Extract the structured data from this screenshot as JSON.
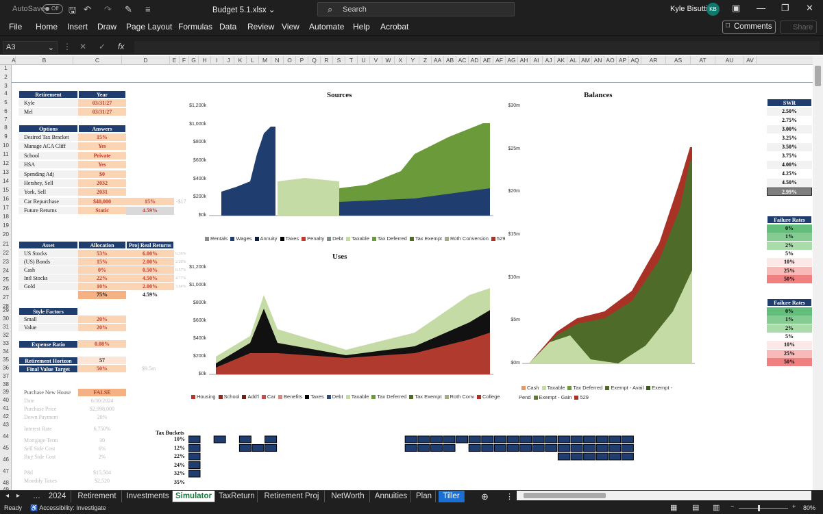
{
  "titlebar": {
    "autosave": "AutoSave",
    "toggle": "Off",
    "filename": "Budget 5.1.xlsx",
    "search": "Search",
    "user": "Kyle Bisutti",
    "initials": "KB"
  },
  "menu": [
    "File",
    "Home",
    "Insert",
    "Draw",
    "Page Layout",
    "Formulas",
    "Data",
    "Review",
    "View",
    "Automate",
    "Help",
    "Acrobat"
  ],
  "buttons": {
    "comments": "Comments",
    "share": "Share"
  },
  "namebox": "A3",
  "columns": [
    "A",
    "B",
    "C",
    "D",
    "E",
    "F",
    "G",
    "H",
    "I",
    "J",
    "K",
    "L",
    "M",
    "N",
    "O",
    "P",
    "Q",
    "R",
    "S",
    "T",
    "U",
    "V",
    "W",
    "X",
    "Y",
    "Z",
    "AA",
    "AB",
    "AC",
    "AD",
    "AE",
    "AF",
    "AG",
    "AH",
    "AI",
    "AJ",
    "AK",
    "AL",
    "AM",
    "AN",
    "AO",
    "AP",
    "AQ",
    "AR",
    "AS",
    "AT",
    "AU",
    "AV"
  ],
  "rows": [
    "1",
    "2",
    "3",
    "4",
    "5",
    "6",
    "7",
    "8",
    "9",
    "10",
    "11",
    "12",
    "13",
    "14",
    "15",
    "16",
    "17",
    "18",
    "19",
    "20",
    "21",
    "22",
    "23",
    "24",
    "25",
    "26",
    "27",
    "28",
    "29",
    "30",
    "31",
    "32",
    "33",
    "34",
    "35",
    "36",
    "37",
    "38",
    "39",
    "40",
    "41",
    "42",
    "43",
    "44",
    "45",
    "46",
    "47",
    "48",
    "49"
  ],
  "retirement": {
    "h1": "Retirement",
    "h2": "Year",
    "rows": [
      [
        "Kyle",
        "03/31/27"
      ],
      [
        "Mel",
        "03/31/27"
      ]
    ]
  },
  "options": {
    "h1": "Options",
    "h2": "Answers",
    "rows": [
      [
        "Desired Tax Bracket",
        "15%"
      ],
      [
        "Manage ACA Cliff",
        "Yes"
      ],
      [
        "School",
        "Private"
      ],
      [
        "HSA",
        "Yes"
      ],
      [
        "Spending Adj",
        "$0"
      ],
      [
        "Hershey, Sell",
        "2032"
      ],
      [
        "York, Sell",
        "2031"
      ],
      [
        "Car Repurchase",
        "$40,000"
      ],
      [
        "Future Returns",
        "Static"
      ]
    ],
    "car_extra": "15%",
    "car_ghost": "-$17",
    "returns_extra": "4.59%"
  },
  "asset": {
    "h1": "Asset",
    "h2": "Allocation",
    "h3": "Proj Real Returns",
    "rows": [
      [
        "US Stocks",
        "53%",
        "6.00%",
        "6.36%"
      ],
      [
        "(US) Bonds",
        "15%",
        "2.00%",
        "2.20%"
      ],
      [
        "Cash",
        "0%",
        "0.50%",
        "0.57%"
      ],
      [
        "Intl Stocks",
        "22%",
        "4.50%",
        "4.77%"
      ],
      [
        "Gold",
        "10%",
        "2.00%",
        "3.64%"
      ]
    ],
    "total_alloc": "75%",
    "total_ret": "4.59%"
  },
  "style": {
    "h1": "Style Factors",
    "rows": [
      [
        "Small",
        "20%"
      ],
      [
        "Value",
        "20%"
      ]
    ]
  },
  "expense": {
    "label": "Expense Ratio",
    "value": "0.08%"
  },
  "horizon": {
    "label": "Retirement Horizon",
    "value": "57"
  },
  "target": {
    "label": "Final Value Target",
    "value": "50%",
    "ghost": "$9.5m"
  },
  "house": {
    "label": "Purchase New House",
    "value": "FALSE",
    "ghost_rows": [
      [
        "Date",
        "6/30/2024"
      ],
      [
        "Purchase Price",
        "$2,998,000"
      ],
      [
        "Down Payment",
        "20%"
      ],
      [
        "Interest Rate",
        "6.750%"
      ],
      [
        "Mortgage Term",
        "30"
      ],
      [
        "Sell Side Cost",
        "6%"
      ],
      [
        "Buy Side Cost",
        "2%"
      ],
      [
        "P&I",
        "$15,504"
      ],
      [
        "Monthly Taxes",
        "$2,520"
      ]
    ]
  },
  "swr": {
    "header": "SWR",
    "values": [
      "2.50%",
      "2.75%",
      "3.00%",
      "3.25%",
      "3.50%",
      "3.75%",
      "4.00%",
      "4.25%",
      "4.50%"
    ],
    "result": "2.99%"
  },
  "failure1": {
    "header": "Failure Rates",
    "values": [
      "0%",
      "1%",
      "2%",
      "5%",
      "10%",
      "25%",
      "50%"
    ]
  },
  "failure2": {
    "header": "Failure Rates",
    "values": [
      "0%",
      "1%",
      "2%",
      "5%",
      "10%",
      "25%",
      "50%"
    ]
  },
  "taxbuckets": {
    "label": "Tax Buckets",
    "brackets": [
      "10%",
      "12%",
      "22%",
      "24%",
      "32%",
      "35%"
    ]
  },
  "sources": {
    "title": "Sources",
    "yticks": [
      "$1,200k",
      "$1,000k",
      "$800k",
      "$600k",
      "$400k",
      "$200k",
      "$0k"
    ],
    "legend": [
      [
        "Rentals",
        "#8c8c8c"
      ],
      [
        "Wages",
        "#1f3d6e"
      ],
      [
        "Annuity",
        "#0b1f3a"
      ],
      [
        "Taxes",
        "#000000"
      ],
      [
        "Penalty",
        "#c0392b"
      ],
      [
        "Debt",
        "#7f8c8d"
      ],
      [
        "Taxable",
        "#c5dba5"
      ],
      [
        "Tax Deferred",
        "#6b9a3a"
      ],
      [
        "Tax Exempt",
        "#4f6b2a"
      ],
      [
        "Roth Conversion",
        "#a8a88a"
      ],
      [
        "529",
        "#a93226"
      ]
    ]
  },
  "uses": {
    "title": "Uses",
    "yticks": [
      "$1,200k",
      "$1,000k",
      "$800k",
      "$600k",
      "$400k",
      "$200k",
      "$0k"
    ],
    "legend": [
      [
        "Housing",
        "#b03a2e"
      ],
      [
        "School",
        "#8e2a20"
      ],
      [
        "Add'l",
        "#6e1f18"
      ],
      [
        "Car",
        "#c0504d"
      ],
      [
        "Benefits",
        "#d98880"
      ],
      [
        "Taxes",
        "#000000"
      ],
      [
        "Debt",
        "#2e4a7a"
      ],
      [
        "Taxable",
        "#c5dba5"
      ],
      [
        "Tax Deferred",
        "#6b9a3a"
      ],
      [
        "Tax Exempt",
        "#4f6b2a"
      ],
      [
        "Roth Conv",
        "#a8a88a"
      ],
      [
        "College",
        "#a93226"
      ]
    ]
  },
  "balances": {
    "title": "Balances",
    "yticks": [
      "$30m",
      "$25m",
      "$20m",
      "$15m",
      "$10m",
      "$5m",
      "$0m"
    ],
    "legend": [
      [
        "Cash",
        "#e59866"
      ],
      [
        "Taxable",
        "#c5dba5"
      ],
      [
        "Tax Deferred",
        "#6b9a3a"
      ],
      [
        "Exempt - Avail",
        "#4f6b2a"
      ],
      [
        "Exempt - Pend",
        "#3d5a20"
      ],
      [
        "Exempt - Gain",
        "#5d7a30"
      ],
      [
        "529",
        "#a93226"
      ]
    ]
  },
  "tabs": [
    "2024",
    "Retirement",
    "Investments",
    "Simulator",
    "TaxReturn",
    "Retirement Proj",
    "NetWorth",
    "Annuities",
    "Plan",
    "Tiller"
  ],
  "status": {
    "ready": "Ready",
    "accessibility": "Accessibility: Investigate",
    "zoom": "80%"
  }
}
